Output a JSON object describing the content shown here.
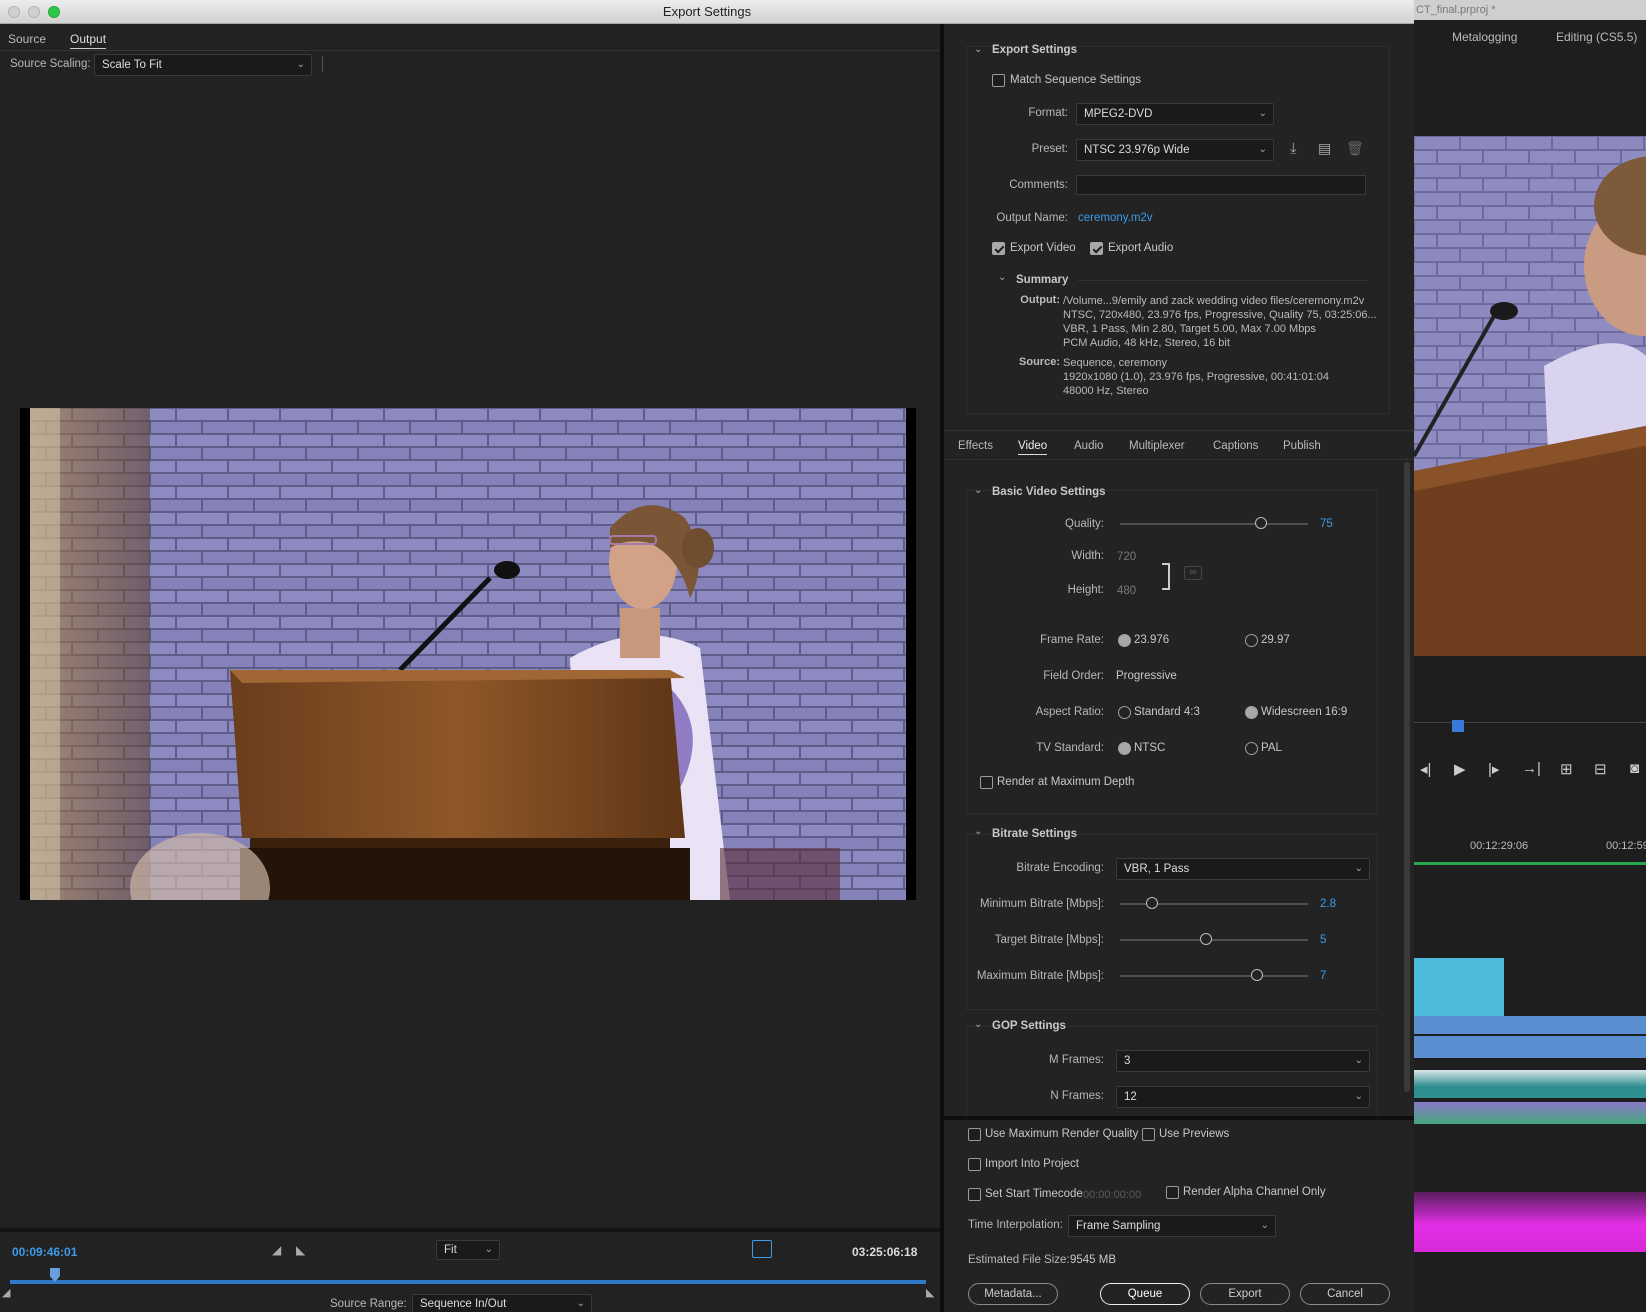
{
  "window": {
    "title": "Export Settings"
  },
  "left": {
    "tabs": [
      {
        "label": "Source"
      },
      {
        "label": "Output"
      }
    ],
    "source_scaling_label": "Source Scaling:",
    "source_scaling_value": "Scale To Fit",
    "timecode_current": "00:09:46:01",
    "fit_value": "Fit",
    "timecode_duration": "03:25:06:18",
    "source_range_label": "Source Range:",
    "source_range_value": "Sequence In/Out",
    "playhead_fraction": 0.049
  },
  "export_settings": {
    "header": "Export Settings",
    "match_sequence": {
      "label": "Match Sequence Settings",
      "checked": false
    },
    "format_label": "Format:",
    "format_value": "MPEG2-DVD",
    "preset_label": "Preset:",
    "preset_value": "NTSC 23.976p Wide",
    "comments_label": "Comments:",
    "comments_value": "",
    "output_name_label": "Output Name:",
    "output_name_value": "ceremony.m2v",
    "export_video": {
      "label": "Export Video",
      "checked": true
    },
    "export_audio": {
      "label": "Export Audio",
      "checked": true
    },
    "summary_header": "Summary",
    "summary_output_label": "Output:",
    "summary_output_lines": [
      "/Volume...9/emily and zack wedding video files/ceremony.m2v",
      "NTSC, 720x480, 23.976 fps, Progressive, Quality 75, 03:25:06...",
      "VBR, 1 Pass, Min 2.80, Target 5.00, Max 7.00 Mbps",
      "PCM Audio, 48 kHz, Stereo, 16 bit"
    ],
    "summary_source_label": "Source:",
    "summary_source_lines": [
      "Sequence, ceremony",
      "1920x1080 (1.0), 23.976 fps, Progressive, 00:41:01:04",
      "48000 Hz, Stereo"
    ]
  },
  "settings_tabs": [
    {
      "label": "Effects"
    },
    {
      "label": "Video"
    },
    {
      "label": "Audio"
    },
    {
      "label": "Multiplexer"
    },
    {
      "label": "Captions"
    },
    {
      "label": "Publish"
    }
  ],
  "basic_video": {
    "header": "Basic Video Settings",
    "quality_label": "Quality:",
    "quality_value": "75",
    "quality_fraction": 0.75,
    "width_label": "Width:",
    "width_value": "720",
    "height_label": "Height:",
    "height_value": "480",
    "frame_rate_label": "Frame Rate:",
    "frame_rate_opt1": "23.976",
    "frame_rate_opt2": "29.97",
    "field_order_label": "Field Order:",
    "field_order_value": "Progressive",
    "aspect_label": "Aspect Ratio:",
    "aspect_opt1": "Standard 4:3",
    "aspect_opt2": "Widescreen 16:9",
    "tv_label": "TV Standard:",
    "tv_opt1": "NTSC",
    "tv_opt2": "PAL",
    "render_max_depth": "Render at Maximum Depth"
  },
  "bitrate": {
    "header": "Bitrate Settings",
    "encoding_label": "Bitrate Encoding:",
    "encoding_value": "VBR, 1 Pass",
    "min_label": "Minimum Bitrate [Mbps]:",
    "min_value": "2.8",
    "min_fraction": 0.17,
    "target_label": "Target Bitrate [Mbps]:",
    "target_value": "5",
    "target_fraction": 0.46,
    "max_label": "Maximum Bitrate [Mbps]:",
    "max_value": "7",
    "max_fraction": 0.73
  },
  "gop": {
    "header": "GOP Settings",
    "m_label": "M Frames:",
    "m_value": "3",
    "n_label": "N Frames:",
    "n_value": "12"
  },
  "bottom": {
    "max_render_quality": "Use Maximum Render Quality",
    "use_previews": "Use Previews",
    "import_into_project": "Import Into Project",
    "set_start_timecode": "Set Start Timecode",
    "start_timecode_value": "00:00:00:00",
    "render_alpha": "Render Alpha Channel Only",
    "time_interp_label": "Time Interpolation:",
    "time_interp_value": "Frame Sampling",
    "file_size_label": "Estimated File Size:",
    "file_size_value": "9545 MB",
    "metadata_button": "Metadata...",
    "queue_button": "Queue",
    "export_button": "Export",
    "cancel_button": "Cancel"
  },
  "background_app": {
    "project_title": "CT_final.prproj *",
    "tab_metalogging": "Metalogging",
    "tab_editing": "Editing (CS5.5)",
    "timecode": "00:12:29:06",
    "timecode2": "00:12:59"
  }
}
